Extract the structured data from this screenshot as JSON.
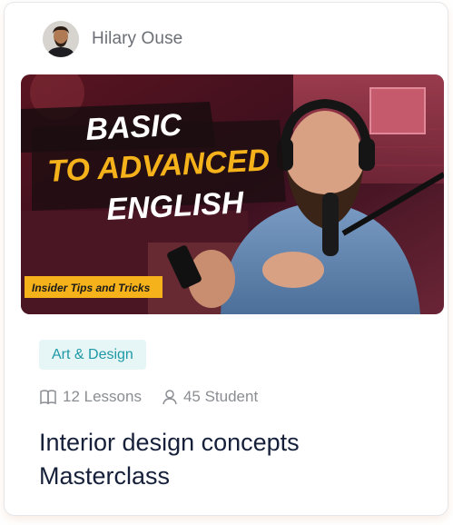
{
  "author": {
    "name": "Hilary Ouse"
  },
  "thumbnail": {
    "line1": "BASIC",
    "line2": "TO ADVANCED",
    "line3": "ENGLISH",
    "tagline": "Insider Tips and Tricks"
  },
  "course": {
    "category": "Art & Design",
    "lessons": "12 Lessons",
    "students": "45 Student",
    "title_line1": "Interior design concepts",
    "title_line2": "Masterclass"
  },
  "colors": {
    "category_bg": "#e6f6f6",
    "category_text": "#1e98a5",
    "title": "#16203a",
    "accent_yellow": "#f6b21b"
  }
}
